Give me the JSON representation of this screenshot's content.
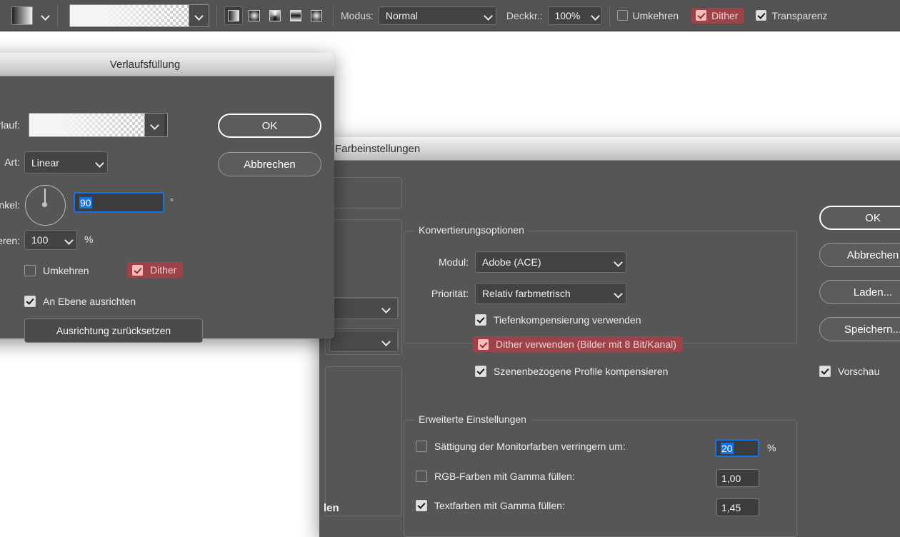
{
  "options_bar": {
    "tool_preset_icon": "gradient-preset-icon",
    "gradient_preset_icon": "gradient-swatch-icon",
    "gradient_types": [
      {
        "name": "linear-gradient-button",
        "label": "Linear",
        "active": true
      },
      {
        "name": "radial-gradient-button",
        "label": "Radial",
        "active": false
      },
      {
        "name": "angle-gradient-button",
        "label": "Winkel",
        "active": false
      },
      {
        "name": "reflected-gradient-button",
        "label": "Reflektiert",
        "active": false
      },
      {
        "name": "diamond-gradient-button",
        "label": "Diamant",
        "active": false
      }
    ],
    "mode_label": "Modus:",
    "mode_value": "Normal",
    "opacity_label": "Deckkr.:",
    "opacity_value": "100%",
    "invert_label": "Umkehren",
    "invert_checked": false,
    "dither_label": "Dither",
    "dither_checked": true,
    "transparency_label": "Transparenz",
    "transparency_checked": true
  },
  "gradient_dialog": {
    "title": "Verlaufsfüllung",
    "gradient_label": "Verlauf:",
    "style_label": "Art:",
    "style_value": "Linear",
    "angle_label": "Winkel:",
    "angle_value": "90",
    "angle_unit": "°",
    "scale_label": "Skalieren:",
    "scale_value": "100",
    "scale_unit": "%",
    "invert_label": "Umkehren",
    "invert_checked": false,
    "dither_label": "Dither",
    "dither_checked": true,
    "align_label": "An Ebene ausrichten",
    "align_checked": true,
    "reset_button": "Ausrichtung zurücksetzen",
    "ok_button": "OK",
    "cancel_button": "Abbrechen"
  },
  "color_settings_dialog": {
    "title": "Farbeinstellungen",
    "conversion": {
      "legend": "Konvertierungsoptionen",
      "module_label": "Modul:",
      "module_value": "Adobe (ACE)",
      "intent_label": "Priorität:",
      "intent_value": "Relativ farbmetrisch",
      "black_point_label": "Tiefenkompensierung verwenden",
      "black_point_checked": true,
      "dither_label": "Dither verwenden (Bilder mit 8 Bit/Kanal)",
      "dither_checked": true,
      "scene_profiles_label": "Szenenbezogene Profile kompensieren",
      "scene_profiles_checked": true
    },
    "advanced": {
      "legend": "Erweiterte Einstellungen",
      "desaturate_label": "Sättigung der Monitorfarben verringern um:",
      "desaturate_checked": false,
      "desaturate_value": "20",
      "desaturate_unit": "%",
      "rgb_gamma_label": "RGB-Farben mit Gamma füllen:",
      "rgb_gamma_checked": false,
      "rgb_gamma_value": "1,00",
      "text_gamma_label": "Textfarben mit Gamma füllen:",
      "text_gamma_checked": true,
      "text_gamma_value": "1,45"
    },
    "buttons": {
      "ok": "OK",
      "cancel": "Abbrechen",
      "load": "Laden...",
      "save": "Speichern..."
    },
    "preview_label": "Vorschau",
    "preview_checked": true,
    "occluded_text": "len"
  }
}
